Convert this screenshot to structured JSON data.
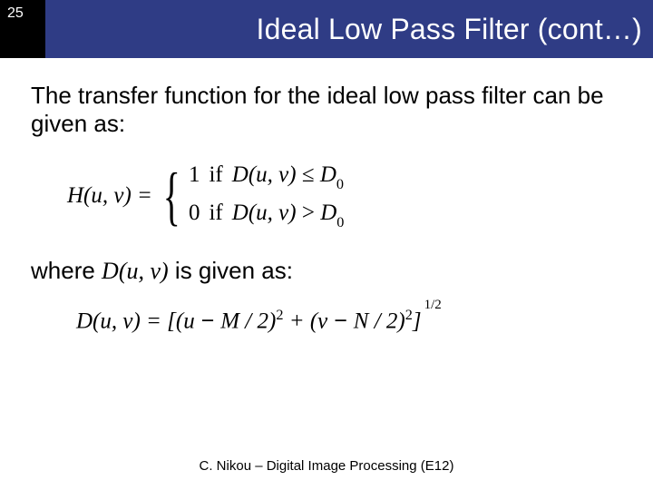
{
  "page_number": "25",
  "title": "Ideal Low Pass Filter (cont…)",
  "intro": "The transfer function for the ideal low pass filter can be given as:",
  "eq1": {
    "lhs": "H(u, v) =",
    "case1_val": "1",
    "case1_if": "if",
    "case1_cond_left": "D(u, v)",
    "case1_rel": "≤",
    "case1_rhs_base": "D",
    "case1_rhs_sub": "0",
    "case2_val": "0",
    "case2_if": "if",
    "case2_cond_left": "D(u, v)",
    "case2_rel": ">",
    "case2_rhs_base": "D",
    "case2_rhs_sub": "0"
  },
  "bridge_pre": "where ",
  "bridge_var": "D(u, v)",
  "bridge_post": " is given as:",
  "eq2": {
    "lhs": "D(u, v) = [(u",
    "minus1": " − ",
    "mid1": "M / 2)",
    "sq1": "2",
    "plus": " + (v",
    "minus2": " − ",
    "mid2": "N / 2)",
    "sq2": "2",
    "close": "]",
    "outer_exp": "1/2"
  },
  "footer": "C. Nikou – Digital Image Processing (E12)"
}
